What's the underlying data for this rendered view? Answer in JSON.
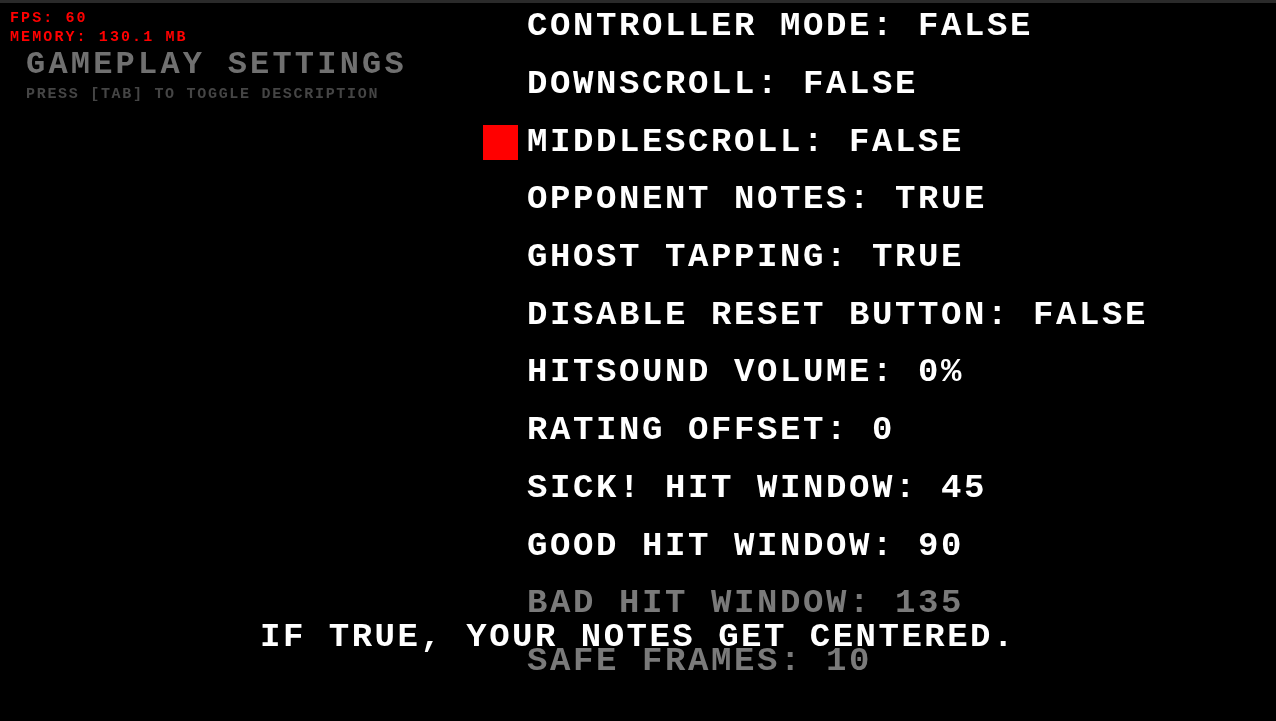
{
  "hud": {
    "fps": "FPS: 60",
    "memory": "MEMORY: 130.1 MB"
  },
  "header": {
    "title": "GAMEPLAY SETTINGS",
    "hint": "PRESS [TAB] TO TOGGLE DESCRIPTION"
  },
  "options": [
    {
      "label": "CONTROLLER MODE: FALSE",
      "selected": false,
      "dimmed": false
    },
    {
      "label": "DOWNSCROLL: FALSE",
      "selected": false,
      "dimmed": false
    },
    {
      "label": "MIDDLESCROLL: FALSE",
      "selected": true,
      "dimmed": false
    },
    {
      "label": "OPPONENT NOTES: TRUE",
      "selected": false,
      "dimmed": false
    },
    {
      "label": "GHOST TAPPING: TRUE",
      "selected": false,
      "dimmed": false
    },
    {
      "label": "DISABLE RESET BUTTON: FALSE",
      "selected": false,
      "dimmed": false
    },
    {
      "label": "HITSOUND VOLUME: 0%",
      "selected": false,
      "dimmed": false
    },
    {
      "label": "RATING OFFSET: 0",
      "selected": false,
      "dimmed": false
    },
    {
      "label": "SICK! HIT WINDOW: 45",
      "selected": false,
      "dimmed": false
    },
    {
      "label": "GOOD HIT WINDOW: 90",
      "selected": false,
      "dimmed": false
    },
    {
      "label": "BAD HIT WINDOW: 135",
      "selected": false,
      "dimmed": true
    },
    {
      "label": "SAFE FRAMES: 10",
      "selected": false,
      "dimmed": true
    }
  ],
  "description": "IF TRUE, YOUR NOTES GET CENTERED."
}
